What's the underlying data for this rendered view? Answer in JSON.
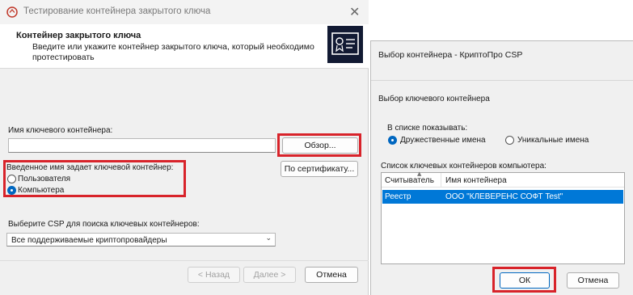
{
  "dialog1": {
    "title": "Тестирование контейнера закрытого ключа",
    "close_glyph": "✕",
    "header": {
      "title": "Контейнер закрытого ключа",
      "description": "Введите или укажите контейнер закрытого ключа, который необходимо протестировать"
    },
    "key_container_label": "Имя ключевого контейнера:",
    "key_container_value": "",
    "browse_button": "Обзор...",
    "by_cert_button": "По сертификату...",
    "key_type_group_label": "Введенное имя задает ключевой контейнер:",
    "key_type_options": [
      {
        "label": "Пользователя",
        "selected": false
      },
      {
        "label": "Компьютера",
        "selected": true
      }
    ],
    "csp_label": "Выберите CSP для поиска ключевых контейнеров:",
    "csp_selected": "Все поддерживаемые криптопровайдеры",
    "back_button": "< Назад",
    "next_button": "Далее >",
    "cancel_button": "Отмена"
  },
  "dialog2": {
    "title": "Выбор контейнера - КриптоПро CSP",
    "section_label": "Выбор ключевого контейнера",
    "show_group_label": "В списке показывать:",
    "show_options": [
      {
        "label": "Дружественные имена",
        "selected": true
      },
      {
        "label": "Уникальные имена",
        "selected": false
      }
    ],
    "list_label": "Список ключевых контейнеров компьютера:",
    "columns": [
      "Считыватель",
      "Имя контейнера"
    ],
    "rows": [
      {
        "reader": "Реестр",
        "name": "ООО \"КЛЕВЕРЕНС СОФТ Test\"",
        "selected": true
      }
    ],
    "ok_button": "ОК",
    "cancel_button": "Отмена"
  },
  "colors": {
    "highlight_red": "#d8232a",
    "selection_blue": "#0078d7",
    "accent_blue": "#0067c0"
  }
}
